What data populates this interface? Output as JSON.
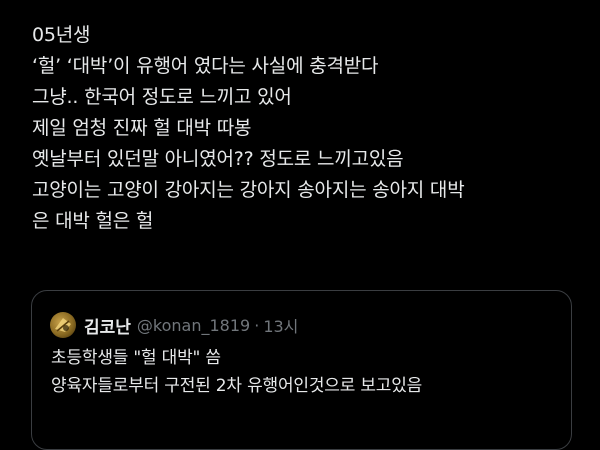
{
  "post": {
    "lines": [
      "05년생",
      "‘헐’ ‘대박’이 유행어 였다는 사실에 충격받다",
      "그냥.. 한국어 정도로 느끼고 있어",
      "제일 엄청 진짜 헐 대박 따봉",
      "옛날부터 있던말 아니였어?? 정도로 느끼고있음",
      "고양이는 고양이 강아지는 강아지 송아지는 송아지 대박",
      "은 대박 헐은 헐"
    ]
  },
  "quote": {
    "avatar_icon": "avatar-gold-emblem-icon",
    "display_name": "김코난",
    "handle": "@konan_1819",
    "separator": "·",
    "time": "13시",
    "lines": [
      "초등학생들 \"헐 대박\" 씀",
      "양육자들로부터 구전된 2차 유행어인것으로 보고있음"
    ]
  },
  "colors": {
    "background": "#000000",
    "text": "#e7e9ea",
    "secondary_text": "#71767b",
    "border": "#3a3d41"
  }
}
